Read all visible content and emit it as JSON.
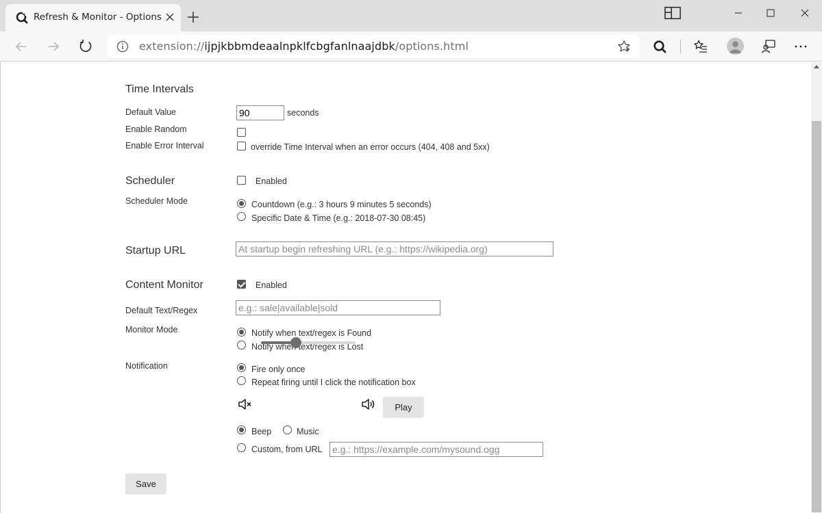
{
  "browser": {
    "tab_title": "Refresh & Monitor - Options",
    "url_scheme": "extension://",
    "url_host": "ijpjkbbmdeaalnpklfcbgfanlnaajdbk",
    "url_path": "/options.html"
  },
  "time_intervals": {
    "heading": "Time Intervals",
    "default_value_label": "Default Value",
    "default_value": "90",
    "default_value_unit": "seconds",
    "enable_random_label": "Enable Random",
    "enable_random_checked": false,
    "enable_error_label": "Enable Error Interval",
    "enable_error_checked": false,
    "enable_error_desc": "override Time Interval when an error occurs (404, 408 and 5xx)"
  },
  "scheduler": {
    "heading": "Scheduler",
    "enabled_label": "Enabled",
    "enabled_checked": false,
    "mode_label": "Scheduler Mode",
    "mode_options": [
      {
        "label": "Countdown (e.g.: 3 hours 9 minutes 5 seconds)",
        "checked": true
      },
      {
        "label": "Specific Date & Time (e.g.: 2018-07-30 08:45)",
        "checked": false
      }
    ]
  },
  "startup": {
    "heading": "Startup URL",
    "placeholder": "At startup begin refreshing URL (e.g.: https://wikipedia.org)"
  },
  "content_monitor": {
    "heading": "Content Monitor",
    "enabled_label": "Enabled",
    "enabled_checked": true,
    "text_label": "Default Text/Regex",
    "text_placeholder": "e.g.: sale|available|sold",
    "mode_label": "Monitor Mode",
    "mode_options": [
      {
        "label": "Notify when text/regex is Found",
        "checked": true
      },
      {
        "label": "Notify when text/regex is Lost",
        "checked": false
      }
    ]
  },
  "notification": {
    "label": "Notification",
    "fire_options": [
      {
        "label": "Fire only once",
        "checked": true
      },
      {
        "label": "Repeat firing until I click the notification box",
        "checked": false
      }
    ],
    "volume_fraction": 0.37,
    "play_label": "Play",
    "sound_beep_label": "Beep",
    "sound_beep_checked": true,
    "sound_music_label": "Music",
    "sound_music_checked": false,
    "sound_custom_label": "Custom, from URL",
    "sound_custom_checked": false,
    "custom_placeholder": "e.g.: https://example.com/mysound.ogg"
  },
  "save_label": "Save"
}
